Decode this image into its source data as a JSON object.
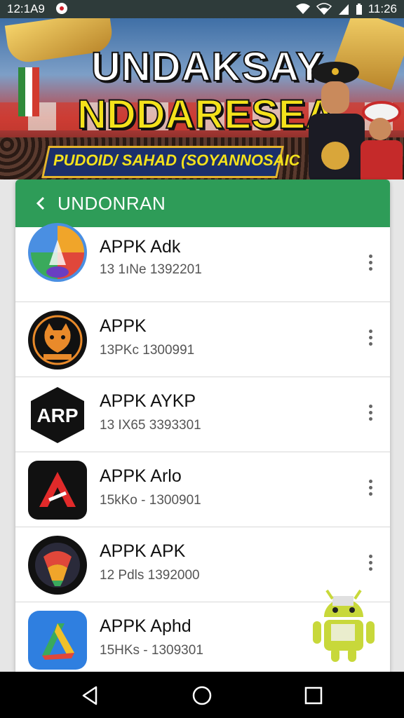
{
  "status_bar": {
    "time": "12:1A9",
    "battery": "11:26"
  },
  "banner": {
    "title_line1": "UNDAKSAY",
    "title_line2": "NDDARESEA",
    "subtitle": "PUDOID/ SAHAD (SOYANNOSAIC"
  },
  "panel": {
    "back_label": "<",
    "title": "UNDONRAN"
  },
  "apps": [
    {
      "name": "APPK Adk",
      "meta": "13 1ıNe  1392201",
      "icon": "google-drive-style-icon"
    },
    {
      "name": "APPK",
      "meta": "13ΡKc  1300991",
      "icon": "cat-badge-icon"
    },
    {
      "name": "APPK AYKP",
      "meta": "13 IX65  3393301",
      "icon": "arp-hexagon-icon"
    },
    {
      "name": "APPK Arlo",
      "meta": "15kKo - 1300901",
      "icon": "red-a-logo-icon"
    },
    {
      "name": "APPK APK",
      "meta": "12 Pdls  1392000",
      "icon": "colorful-emblem-icon"
    },
    {
      "name": "APPK Aphd",
      "meta": "15HKs - 1309301",
      "icon": "blue-drive-triangle-icon"
    }
  ],
  "colors": {
    "header_green": "#2e9c58",
    "status_bar_bg": "#2e3b3a",
    "nav_bar_bg": "#000000"
  }
}
